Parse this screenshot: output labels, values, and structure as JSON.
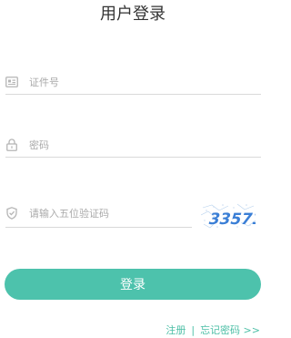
{
  "page": {
    "title": "用户登录"
  },
  "form": {
    "id_number": {
      "placeholder": "证件号",
      "value": "",
      "icon": "id-card-icon"
    },
    "password": {
      "placeholder": "密码",
      "value": "",
      "icon": "lock-icon"
    },
    "captcha_input": {
      "placeholder": "请输入五位验证码",
      "value": "",
      "icon": "shield-icon"
    },
    "captcha_image": {
      "code": "33571"
    },
    "login_button_label": "登录"
  },
  "links": {
    "register_label": "注册",
    "separator": "|",
    "forgot_password_label": "忘记密码 >>"
  },
  "colors": {
    "accent": "#4dc2ac",
    "link": "#4dbfa6",
    "icon": "#b5b5b5",
    "captcha_text": "#3b7fd6"
  }
}
